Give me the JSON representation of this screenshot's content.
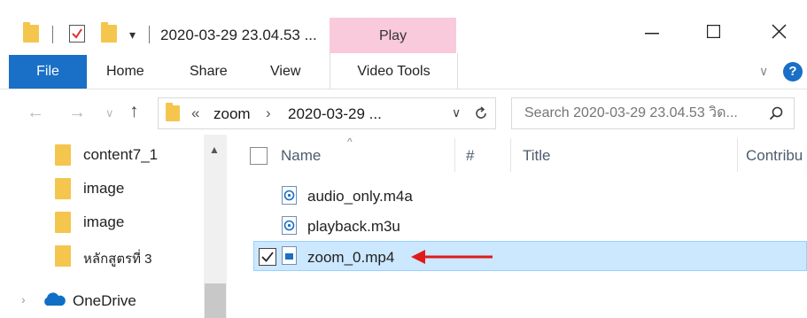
{
  "window": {
    "title": "2020-03-29 23.04.53 ...",
    "context_tab_group": "Play",
    "controls": {
      "minimize": "—",
      "maximize": "☐",
      "close": "✕"
    }
  },
  "ribbon": {
    "tabs": [
      {
        "label": "File",
        "active": true
      },
      {
        "label": "Home"
      },
      {
        "label": "Share"
      },
      {
        "label": "View"
      },
      {
        "label": "Video Tools"
      }
    ],
    "help": "?"
  },
  "address": {
    "overflow": "«",
    "breadcrumbs": [
      "zoom",
      "2020-03-29 ..."
    ],
    "separator": "›"
  },
  "search": {
    "placeholder": "Search 2020-03-29 23.04.53 วิด..."
  },
  "nav_pane": {
    "items": [
      {
        "label": "content7_1",
        "icon": "folder-icon"
      },
      {
        "label": "image",
        "icon": "folder-icon"
      },
      {
        "label": "image",
        "icon": "folder-icon"
      },
      {
        "label": "หลักสูตรที่ 3",
        "icon": "folder-icon"
      },
      {
        "label": "OneDrive",
        "icon": "onedrive-icon"
      }
    ]
  },
  "columns": [
    "Name",
    "#",
    "Title",
    "Contribu"
  ],
  "files": [
    {
      "name": "audio_only.m4a",
      "icon": "media-file-icon",
      "selected": false
    },
    {
      "name": "playback.m3u",
      "icon": "playlist-file-icon",
      "selected": false
    },
    {
      "name": "zoom_0.mp4",
      "icon": "video-file-icon",
      "selected": true
    }
  ],
  "colors": {
    "file_tab": "#1a6fc6",
    "play_tab": "#f9c9dc",
    "selection": "#cce8ff",
    "arrow": "#e01b1b",
    "folder": "#f4c64e"
  }
}
